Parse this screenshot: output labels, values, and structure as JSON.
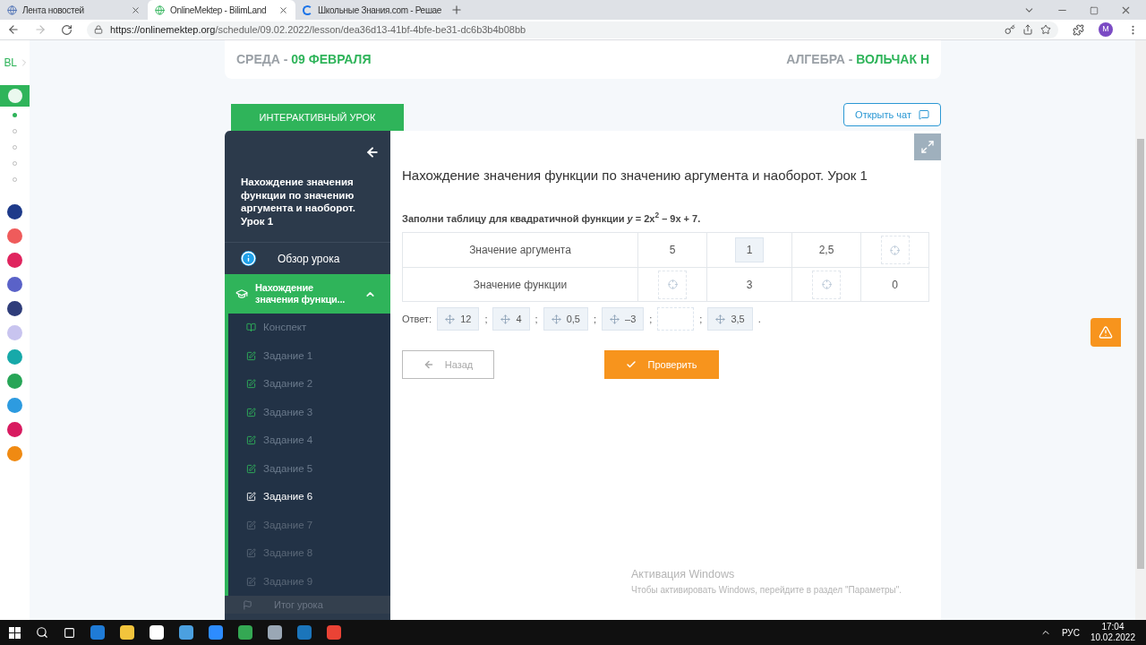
{
  "browser": {
    "tabs": [
      {
        "title": "Лента новостей",
        "selected": false,
        "loading": false
      },
      {
        "title": "OnlineMektep - BilimLand",
        "selected": true,
        "loading": false
      },
      {
        "title": "Школьные Знания.com - Решае",
        "selected": false,
        "loading": true
      }
    ],
    "url_host": "https://onlinemektep.org",
    "url_path": "/schedule/09.02.2022/lesson/dea36d13-41bf-4bfe-be31-dc6b3b4b08bb",
    "profile": "M"
  },
  "rail": {
    "logo": "BL",
    "dots": [
      {
        "selected": true
      },
      {
        "selected": false
      },
      {
        "selected": false
      },
      {
        "selected": false
      },
      {
        "selected": false
      }
    ],
    "apps": [
      {
        "color": "#1e3a8a"
      },
      {
        "color": "#ef5b5b"
      },
      {
        "color": "#e0245e"
      },
      {
        "color": "#5a62c8"
      },
      {
        "color": "#2f3d7a"
      },
      {
        "color": "#c8c4ef"
      },
      {
        "color": "#17a9a9"
      },
      {
        "color": "#27a557"
      },
      {
        "color": "#2d9be0"
      },
      {
        "color": "#d81b60"
      },
      {
        "color": "#f08a12"
      }
    ]
  },
  "header": {
    "day": "СРЕДА -",
    "date": "09 ФЕВРАЛЯ",
    "subject": "АЛГЕБРА -",
    "teacher": "ВОЛЬЧАК Н"
  },
  "lesson_tab": "ИНТЕРАКТИВНЫЙ УРОК",
  "chat_button": "Открыть чат",
  "sidebar": {
    "title": "Нахождение значения функции по значению аргумента и наоборот. Урок 1",
    "overview": "Обзор урока",
    "section": {
      "title": "Нахождение значения функци...",
      "expanded": true
    },
    "items": [
      {
        "label": "Конспект",
        "kind": "notes",
        "completed": true,
        "selected": false
      },
      {
        "label": "Задание 1",
        "kind": "task",
        "completed": true,
        "selected": false
      },
      {
        "label": "Задание 2",
        "kind": "task",
        "completed": true,
        "selected": false
      },
      {
        "label": "Задание 3",
        "kind": "task",
        "completed": true,
        "selected": false
      },
      {
        "label": "Задание 4",
        "kind": "task",
        "completed": true,
        "selected": false
      },
      {
        "label": "Задание 5",
        "kind": "task",
        "completed": true,
        "selected": false
      },
      {
        "label": "Задание 6",
        "kind": "task",
        "selected": true
      },
      {
        "label": "Задание 7",
        "kind": "task",
        "completed": false,
        "selected": false
      },
      {
        "label": "Задание 8",
        "kind": "task",
        "completed": false,
        "selected": false
      },
      {
        "label": "Задание 9",
        "kind": "task",
        "completed": false,
        "selected": false
      }
    ],
    "summary": "Итог урока"
  },
  "task": {
    "title": "Нахождение значения функции по значению аргумента и наоборот. Урок 1",
    "prompt": "Заполни таблицу для квадратичной функции *y* = 2x$^{2}$ – 9x + 7.",
    "rows": [
      [
        {
          "kind": "text",
          "text": "Значение аргумента"
        },
        {
          "kind": "text",
          "text": "5"
        },
        {
          "kind": "tile",
          "text": "1"
        },
        {
          "kind": "text",
          "text": "2,5"
        },
        {
          "kind": "slot"
        }
      ],
      [
        {
          "kind": "text",
          "text": "Значение функции"
        },
        {
          "kind": "slot"
        },
        {
          "kind": "text",
          "text": "3"
        },
        {
          "kind": "slot"
        },
        {
          "kind": "text",
          "text": "0"
        }
      ]
    ],
    "answer_label": "Ответ:",
    "separator": ";",
    "end": ".",
    "tiles": [
      {
        "kind": "tile",
        "text": "12"
      },
      {
        "kind": "tile",
        "text": "4"
      },
      {
        "kind": "tile",
        "text": "0,5"
      },
      {
        "kind": "tile",
        "text": "–3"
      },
      {
        "kind": "empty"
      },
      {
        "kind": "tile",
        "text": "3,5"
      }
    ],
    "back_button": "Назад",
    "check_button": "Проверить"
  },
  "activation": {
    "title": "Активация Windows",
    "text": "Чтобы активировать Windows, перейдите в раздел \"Параметры\"."
  },
  "taskbar": {
    "lang": "РУС",
    "time": "17:04",
    "date": "10.02.2022"
  }
}
